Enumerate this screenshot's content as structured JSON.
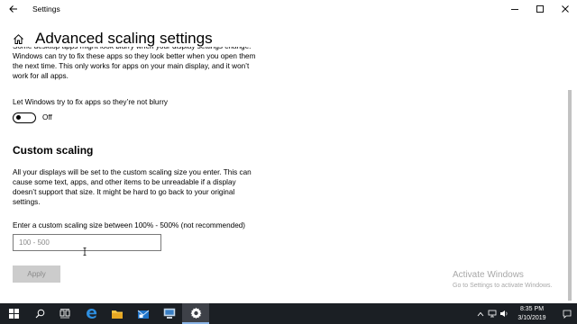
{
  "window": {
    "title": "Settings"
  },
  "page": {
    "title": "Advanced scaling settings"
  },
  "fix_apps": {
    "description": "Some desktop apps might look blurry when your display settings change. Windows can try to fix these apps so they look better when you open them the next time. This only works for apps on your main display, and it won’t work for all apps.",
    "toggle_label": "Let Windows try to fix apps so they’re not blurry",
    "toggle_state": "Off"
  },
  "custom_scaling": {
    "title": "Custom scaling",
    "description": "All your displays will be set to the custom scaling size you enter. This can cause some text, apps, and other items to be unreadable if a display doesn’t support that size. It might be hard to go back to your original settings.",
    "input_label": "Enter a custom scaling size between 100% - 500% (not recommended)",
    "input_value": "",
    "input_placeholder": "100 - 500",
    "apply_label": "Apply"
  },
  "watermark": {
    "line1": "Activate Windows",
    "line2": "Go to Settings to activate Windows."
  },
  "taskbar": {
    "apps": [
      "start-icon",
      "search-icon",
      "task-view-icon",
      "edge-icon",
      "file-explorer-icon",
      "mail-icon",
      "remote-desktop-icon",
      "settings-icon"
    ],
    "time": "8:35 PM",
    "date": "3/10/2019"
  },
  "colors": {
    "taskbar": "#1b1f24",
    "active_app_underline": "#8ab4e6",
    "watermark": "#a8a8a8",
    "button_disabled": "#cccccc"
  }
}
